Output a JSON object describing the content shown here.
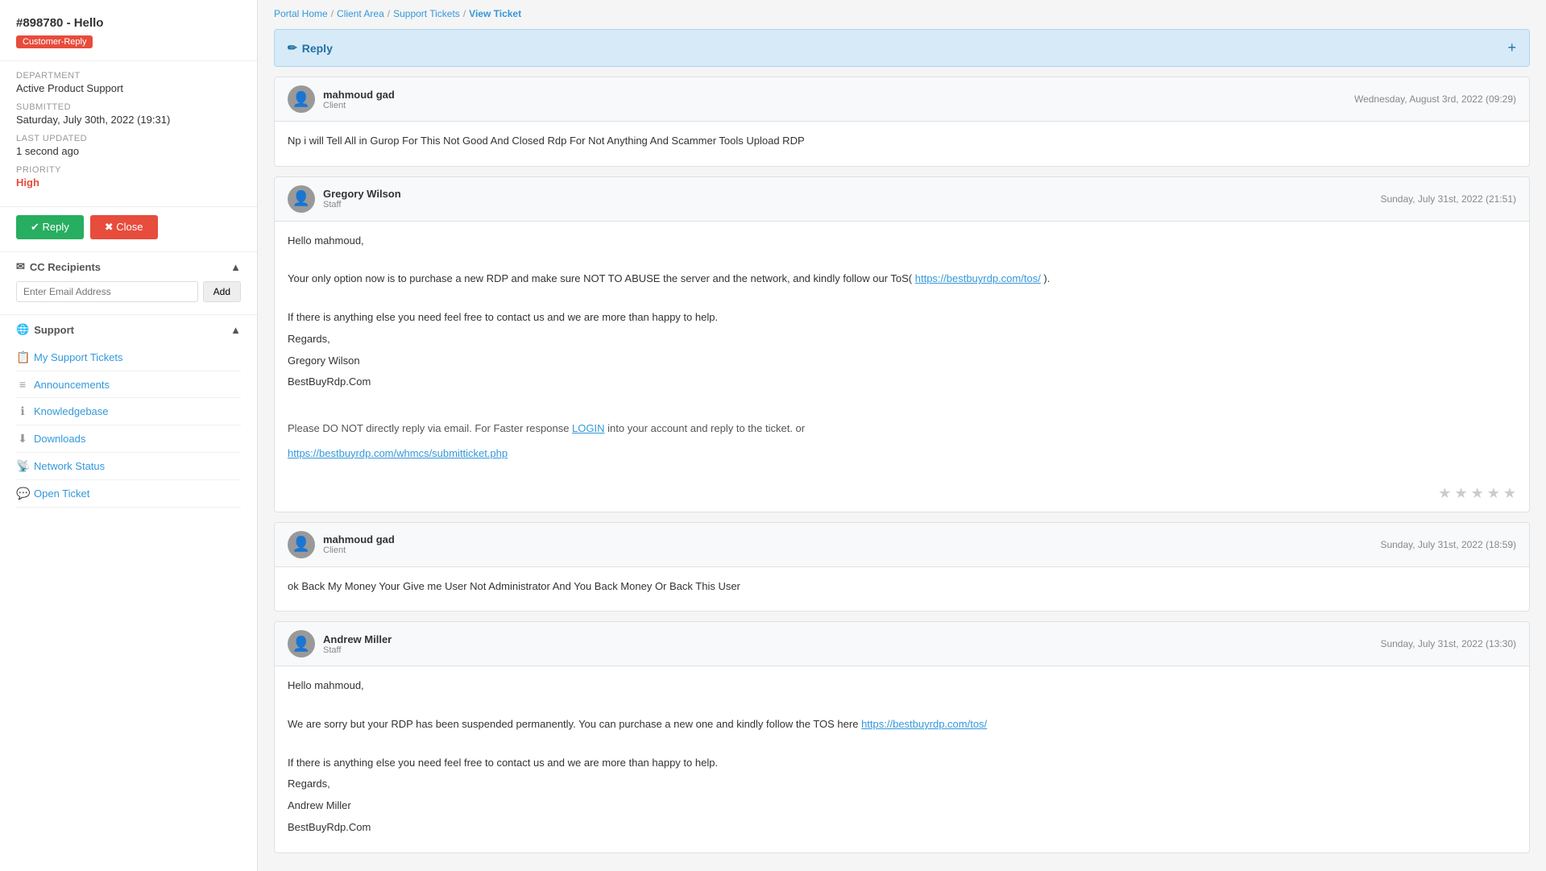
{
  "sidebar": {
    "ticket_title": "#898780 - Hello",
    "badge_label": "Customer-Reply",
    "meta": {
      "department_label": "Department",
      "department_value": "Active Product Support",
      "submitted_label": "Submitted",
      "submitted_value": "Saturday, July 30th, 2022 (19:31)",
      "last_updated_label": "Last Updated",
      "last_updated_value": "1 second ago",
      "priority_label": "Priority",
      "priority_value": "High"
    },
    "reply_button": "✔ Reply",
    "close_button": "✖ Close",
    "cc_section_title": "CC Recipients",
    "email_placeholder": "Enter Email Address",
    "add_button": "Add",
    "support_section_title": "Support",
    "nav_items": [
      {
        "label": "My Support Tickets",
        "icon": "📋"
      },
      {
        "label": "Announcements",
        "icon": "≡"
      },
      {
        "label": "Knowledgebase",
        "icon": "ℹ"
      },
      {
        "label": "Downloads",
        "icon": "⬇"
      },
      {
        "label": "Network Status",
        "icon": "📡"
      },
      {
        "label": "Open Ticket",
        "icon": "💬"
      }
    ]
  },
  "breadcrumb": {
    "portal_home": "Portal Home",
    "client_area": "Client Area",
    "support_tickets": "Support Tickets",
    "view_ticket": "View Ticket"
  },
  "reply_panel": {
    "title": "Reply",
    "plus": "+"
  },
  "messages": [
    {
      "sender": "mahmoud gad",
      "role": "Client",
      "date": "Wednesday, August 3rd, 2022 (09:29)",
      "body": "Np i will Tell All in Gurop For This Not Good And Closed Rdp For Not Anything And Scammer Tools Upload RDP",
      "has_rating": false
    },
    {
      "sender": "Gregory Wilson",
      "role": "Staff",
      "date": "Sunday, July 31st, 2022 (21:51)",
      "body_lines": [
        "Hello mahmoud,",
        "",
        "Your only option now is to purchase a new RDP and make sure NOT TO ABUSE the server and the network, and kindly follow our ToS( https://bestbuyrdp.com/tos/ ).",
        "",
        "If there is anything else you need feel free to contact us and we are more than happy to help.",
        "Regards,",
        "Gregory Wilson",
        "BestBuyRdp.Com"
      ],
      "footer_lines": [
        "Please DO NOT directly reply via email. For Faster response LOGIN into your account and reply to the ticket. or",
        "https://bestbuyrdp.com/whmcs/submitticket.php"
      ],
      "has_rating": true
    },
    {
      "sender": "mahmoud gad",
      "role": "Client",
      "date": "Sunday, July 31st, 2022 (18:59)",
      "body": "ok Back My Money Your Give me User Not Administrator And You Back Money Or Back This User",
      "has_rating": false
    },
    {
      "sender": "Andrew Miller",
      "role": "Staff",
      "date": "Sunday, July 31st, 2022 (13:30)",
      "body_lines": [
        "Hello mahmoud,",
        "",
        "We are sorry but your RDP has been suspended permanently. You can purchase a new one and kindly follow the TOS here https://bestbuyrdp.com/tos/",
        "",
        "If there is anything else you need feel free to contact us and we are more than happy to help.",
        "Regards,",
        "Andrew Miller",
        "BestBuyRdp.Com"
      ],
      "has_rating": false
    }
  ]
}
